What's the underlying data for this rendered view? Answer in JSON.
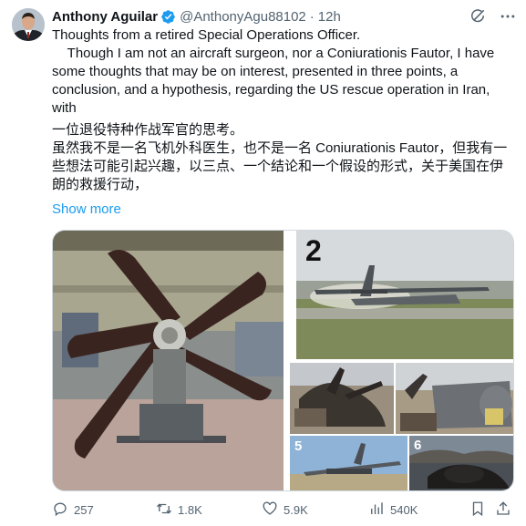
{
  "tweet": {
    "author": {
      "display_name": "Anthony Aguilar",
      "handle": "@AnthonyAgu88102",
      "separator": "·",
      "time": "12h",
      "verified": true,
      "avatar_icon": "profile-photo"
    },
    "header_icons": [
      "grok-icon",
      "more-icon"
    ],
    "text_line_1": "Thoughts from a retired Special Operations Officer.",
    "text_line_2": "    Though I am not an aircraft surgeon, nor a Coniurationis Fautor, I have some thoughts that may be on interest, presented in three points, a conclusion, and a hypothesis, regarding the US rescue operation in Iran, with",
    "text_line_3": "一位退役特种作战军官的思考。",
    "text_line_4": "虽然我不是一名飞机外科医生，也不是一名 Coniurationis Fautor，但我有一些想法可能引起兴趣，以三点、一个结论和一个假设的形式，关于美国在伊朗的救援行动，",
    "show_more": "Show more",
    "media": {
      "photo_2_label": "2",
      "photo_5_label": "5",
      "photo_6_label": "6"
    },
    "actions": {
      "replies": "257",
      "retweets": "1.8K",
      "likes": "5.9K",
      "views": "540K"
    },
    "colors": {
      "link": "#1d9bf0",
      "verified": "#1d9bf0",
      "secondary_text": "#536471"
    }
  }
}
